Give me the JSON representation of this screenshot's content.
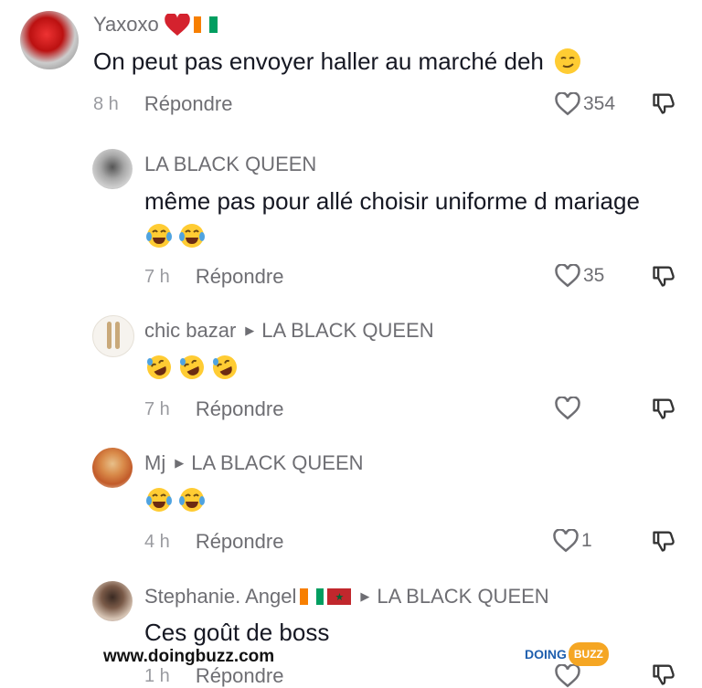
{
  "comments": [
    {
      "user": "Yaxoxo",
      "reply_to": "",
      "text": "On peut pas envoyer haller au marché deh",
      "emojis": [
        "smirk"
      ],
      "time": "8 h",
      "reply": "Répondre",
      "likes": "354"
    },
    {
      "user": "LA BLACK QUEEN",
      "reply_to": "",
      "text": "même pas pour allé choisir uniforme d mariage",
      "emojis": [
        "joy",
        "joy"
      ],
      "time": "7 h",
      "reply": "Répondre",
      "likes": "35"
    },
    {
      "user": "chic  bazar",
      "reply_to": "LA BLACK QUEEN",
      "text": "",
      "emojis": [
        "rofl",
        "rofl",
        "rofl"
      ],
      "time": "7 h",
      "reply": "Répondre",
      "likes": ""
    },
    {
      "user": "Mj",
      "reply_to": "LA BLACK QUEEN",
      "text": "",
      "emojis": [
        "joy",
        "joy"
      ],
      "time": "4 h",
      "reply": "Répondre",
      "likes": "1"
    },
    {
      "user": "Stephanie. Angel",
      "reply_to": "LA BLACK QUEEN",
      "text": "Ces goût de boss",
      "emojis": [],
      "time": "1 h",
      "reply": "Répondre",
      "likes": ""
    }
  ],
  "colors": {
    "heart_red": "#d4222e",
    "ci_orange": "#f77f00",
    "ci_green": "#009e60",
    "ma_red": "#c1272d",
    "text": "#161823",
    "muted": "#6e6e73"
  },
  "watermark": {
    "url": "www.doingbuzz.com",
    "logo_left": "DOING",
    "logo_right": "BUZZ"
  }
}
